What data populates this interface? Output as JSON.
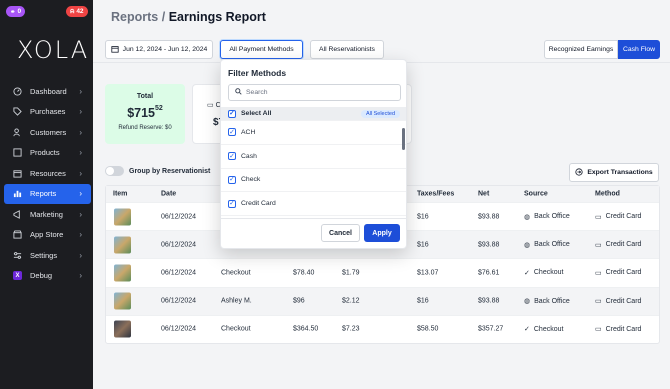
{
  "sidebar": {
    "badge_purple": "0",
    "badge_red": "42",
    "logo": "XOLA",
    "items": [
      {
        "label": "Dashboard",
        "icon": "dashboard-icon"
      },
      {
        "label": "Purchases",
        "icon": "tag-icon"
      },
      {
        "label": "Customers",
        "icon": "users-icon"
      },
      {
        "label": "Products",
        "icon": "box-icon"
      },
      {
        "label": "Resources",
        "icon": "layers-icon"
      },
      {
        "label": "Reports",
        "icon": "chart-icon",
        "active": true
      },
      {
        "label": "Marketing",
        "icon": "megaphone-icon"
      },
      {
        "label": "App Store",
        "icon": "store-icon"
      },
      {
        "label": "Settings",
        "icon": "gear-icon"
      },
      {
        "label": "Debug",
        "icon": "debug-icon"
      }
    ]
  },
  "header": {
    "crumb": "Reports",
    "separator": "/",
    "title": "Earnings Report"
  },
  "toolbar": {
    "date_range": "Jun 12, 2024 - Jun 12, 2024",
    "payment_filter": "All Payment Methods",
    "reservationist_filter": "All Reservationists",
    "recognized": "Recognized Earnings",
    "cashflow": "Cash Flow"
  },
  "summary": {
    "total_label": "Total",
    "total_main": "$715",
    "total_cents": "52",
    "reserve": "Refund Reserve: $0",
    "card2_label": "C",
    "card2_amount": "$7"
  },
  "controls": {
    "group_label": "Group by Reservationist",
    "export": "Export Transactions"
  },
  "table": {
    "headers": {
      "item": "Item",
      "date": "Date",
      "taxes": "Taxes/Fees",
      "net": "Net",
      "source": "Source",
      "method": "Method"
    },
    "rows": [
      {
        "date": "06/12/2024",
        "name": "",
        "amount": "",
        "fee": "",
        "taxes": "$16",
        "net": "$93.88",
        "source": "Back Office",
        "method": "Credit Card"
      },
      {
        "date": "06/12/2024",
        "name": "",
        "amount": "",
        "fee": "",
        "taxes": "$16",
        "net": "$93.88",
        "source": "Back Office",
        "method": "Credit Card"
      },
      {
        "date": "06/12/2024",
        "name": "Checkout",
        "amount": "$78.40",
        "fee": "$1.79",
        "taxes": "$13.07",
        "net": "$76.61",
        "source": "Checkout",
        "method": "Credit Card"
      },
      {
        "date": "06/12/2024",
        "name": "Ashley M.",
        "amount": "$96",
        "fee": "$2.12",
        "taxes": "$16",
        "net": "$93.88",
        "source": "Back Office",
        "method": "Credit Card"
      },
      {
        "date": "06/12/2024",
        "name": "Checkout",
        "amount": "$364.50",
        "fee": "$7.23",
        "taxes": "$58.50",
        "net": "$357.27",
        "source": "Checkout",
        "method": "Credit Card"
      }
    ]
  },
  "filter_popover": {
    "title": "Filter Methods",
    "search_placeholder": "Search",
    "select_all": "Select All",
    "all_selected": "All Selected",
    "options": [
      "ACH",
      "Cash",
      "Check",
      "Credit Card"
    ],
    "cancel": "Cancel",
    "apply": "Apply"
  },
  "colors": {
    "accent": "#1d4ed8",
    "sidebar": "#1c1d21",
    "total_bg": "#dcfce7"
  }
}
